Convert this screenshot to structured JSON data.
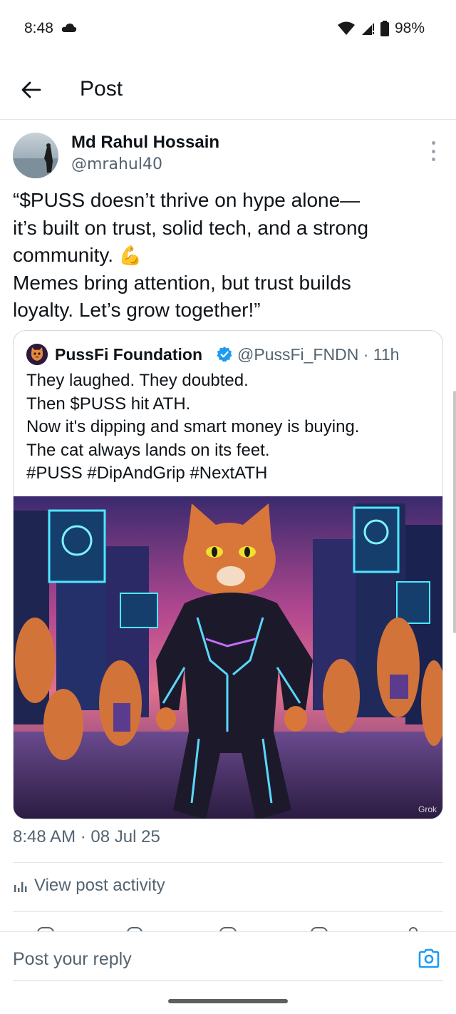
{
  "status_bar": {
    "time": "8:48",
    "battery": "98%",
    "icons": [
      "cloud-icon",
      "wifi-icon",
      "signal-icon",
      "battery-icon"
    ]
  },
  "header": {
    "back_icon": "arrow-left-icon",
    "title": "Post"
  },
  "post": {
    "author_name": "Md Rahul Hossain",
    "author_handle": "@mrahul40",
    "text_lines": [
      "“$PUSS doesn’t thrive on hype alone—",
      "it’s built on trust, solid tech, and a strong",
      "community. ",
      "Memes bring attention, but trust builds",
      "loyalty. Let’s grow together!”"
    ],
    "emoji": "💪",
    "timestamp": "8:48 AM · 08 Jul 25",
    "activity_label": "View post activity"
  },
  "quote": {
    "author_name": "PussFi Foundation",
    "handle_time": "@PussFi_FNDN · 11h",
    "text_lines": [
      "They laughed. They doubted.",
      "Then $PUSS hit ATH.",
      "Now it's dipping and smart money is buying.",
      "The cat always lands on its feet.",
      "#PUSS #DipAndGrip #NextATH"
    ],
    "image_watermark": "Grok"
  },
  "reply": {
    "placeholder": "Post your reply"
  },
  "colors": {
    "text_primary": "#0f1419",
    "text_secondary": "#536471",
    "accent": "#1d9bf0",
    "border": "#cfd9de"
  }
}
